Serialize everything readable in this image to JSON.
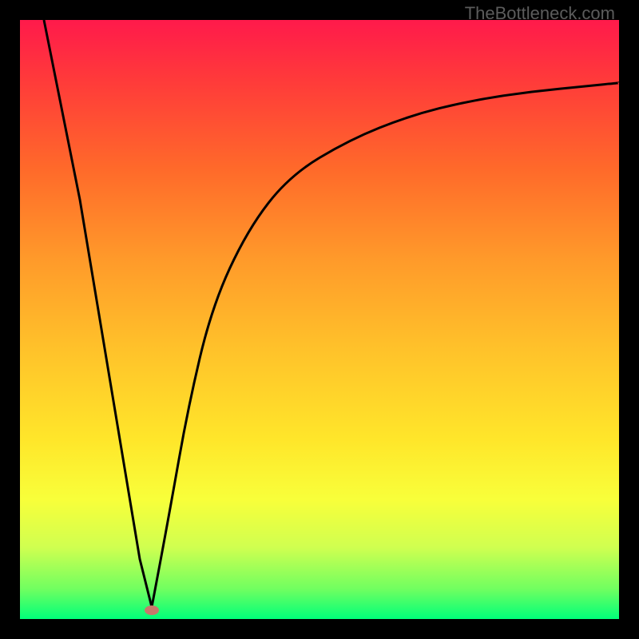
{
  "watermark": "TheBottleneck.com",
  "chart_data": {
    "type": "line",
    "title": "",
    "xlabel": "",
    "ylabel": "",
    "xlim": [
      0,
      100
    ],
    "ylim": [
      0,
      100
    ],
    "grid": false,
    "background_gradient": [
      "#ff1a4b",
      "#ff9a2a",
      "#ffe62a",
      "#00ff7a"
    ],
    "series": [
      {
        "name": "left-branch",
        "x": [
          4,
          10,
          15,
          20,
          22
        ],
        "y": [
          100,
          70,
          40,
          10,
          2
        ]
      },
      {
        "name": "right-branch",
        "x": [
          22,
          25,
          28,
          32,
          38,
          45,
          55,
          65,
          75,
          85,
          95,
          100
        ],
        "y": [
          2,
          18,
          35,
          52,
          65,
          74,
          80,
          84,
          86.5,
          88,
          89,
          89.5
        ]
      }
    ],
    "marker": {
      "x": 22,
      "y": 1.5,
      "color": "#c8786b"
    }
  }
}
